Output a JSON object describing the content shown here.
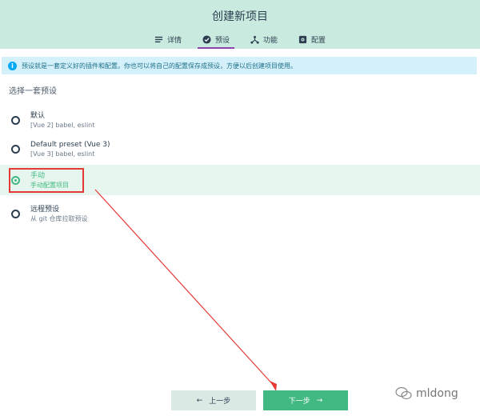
{
  "header": {
    "title": "创建新项目",
    "tabs": [
      {
        "label": "详情",
        "icon": "list-icon",
        "active": false
      },
      {
        "label": "预设",
        "icon": "check-circle-icon",
        "active": true
      },
      {
        "label": "功能",
        "icon": "nodes-icon",
        "active": false
      },
      {
        "label": "配置",
        "icon": "gear-icon",
        "active": false
      }
    ]
  },
  "info": {
    "icon": "info-icon",
    "text": "预设就是一套定义好的插件和配置。你也可以将自己的配置保存成预设，方便以后创建项目使用。"
  },
  "section": {
    "title": "选择一套预设"
  },
  "options": [
    {
      "name": "默认",
      "desc": "[Vue 2] babel, eslint",
      "selected": false
    },
    {
      "name": "Default preset (Vue 3)",
      "desc": "[Vue 3] babel, eslint",
      "selected": false
    },
    {
      "name": "手动",
      "desc": "手动配置项目",
      "selected": true
    },
    {
      "name": "远程预设",
      "desc": "从 git 仓库拉取预设",
      "selected": false
    }
  ],
  "buttons": {
    "prev_label": "上一步",
    "next_label": "下一步"
  },
  "watermark": {
    "text": "mldong"
  },
  "colors": {
    "header_bg": "#c9ebdf",
    "accent": "#42b983",
    "tab_underline": "#8e44ad",
    "annotation": "#e53935"
  }
}
